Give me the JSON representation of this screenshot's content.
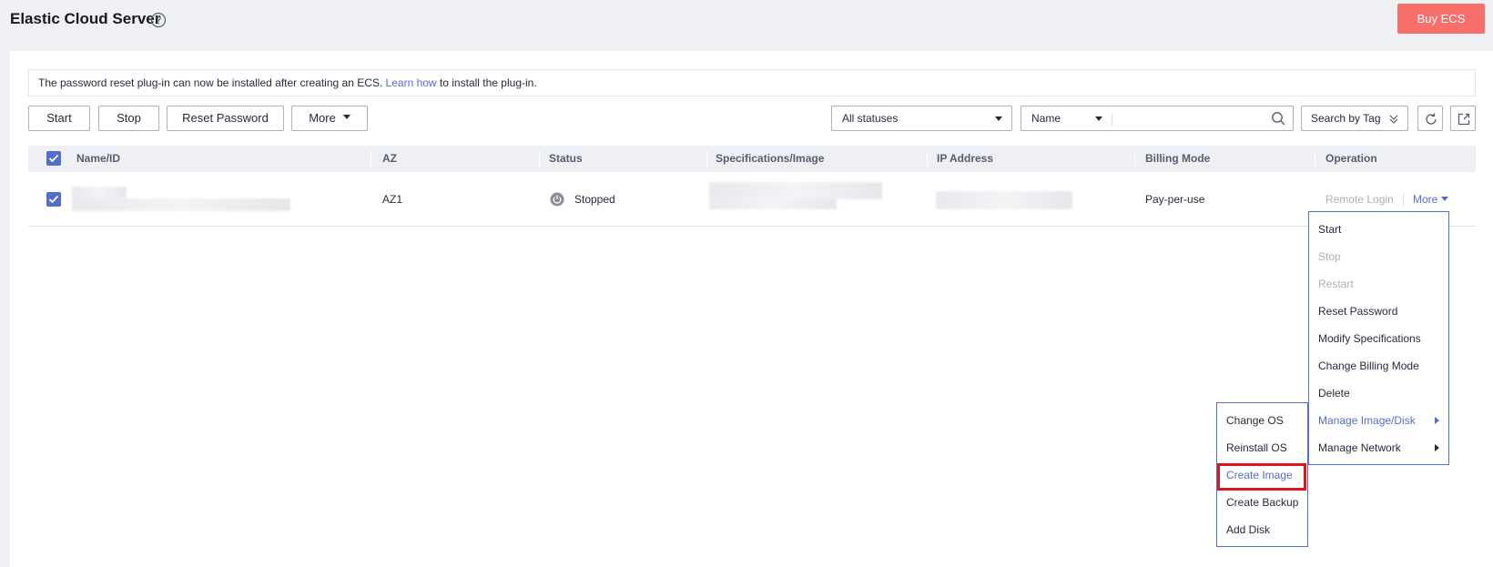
{
  "header": {
    "title": "Elastic Cloud Server",
    "buy_label": "Buy ECS"
  },
  "notice": {
    "text_before": "The password reset plug-in can now be installed after creating an ECS. ",
    "link": "Learn how",
    "text_after": " to install the plug-in."
  },
  "toolbar": {
    "start": "Start",
    "stop": "Stop",
    "reset_password": "Reset Password",
    "more": "More",
    "status_filter": "All statuses",
    "search_field": "Name",
    "search_value": "",
    "search_by_tag": "Search by Tag"
  },
  "table": {
    "columns": [
      "Name/ID",
      "AZ",
      "Status",
      "Specifications/Image",
      "IP Address",
      "Billing Mode",
      "Operation"
    ],
    "row": {
      "az": "AZ1",
      "status": "Stopped",
      "billing": "Pay-per-use",
      "remote_login": "Remote Login",
      "more": "More"
    }
  },
  "more_menu": [
    {
      "label": "Start",
      "state": "normal"
    },
    {
      "label": "Stop",
      "state": "disabled"
    },
    {
      "label": "Restart",
      "state": "disabled"
    },
    {
      "label": "Reset Password",
      "state": "normal"
    },
    {
      "label": "Modify Specifications",
      "state": "normal"
    },
    {
      "label": "Change Billing Mode",
      "state": "normal"
    },
    {
      "label": "Delete",
      "state": "normal"
    },
    {
      "label": "Manage Image/Disk",
      "state": "active"
    },
    {
      "label": "Manage Network",
      "state": "normal"
    }
  ],
  "sub_menu": [
    {
      "label": "Change OS",
      "state": "normal"
    },
    {
      "label": "Reinstall OS",
      "state": "normal"
    },
    {
      "label": "Create Image",
      "state": "active"
    },
    {
      "label": "Create Backup",
      "state": "normal"
    },
    {
      "label": "Add Disk",
      "state": "normal"
    }
  ],
  "colors": {
    "brand": "#526ecc",
    "buy": "#f66f6a",
    "highlight": "#e0141e",
    "disabled": "#adb0b8"
  }
}
